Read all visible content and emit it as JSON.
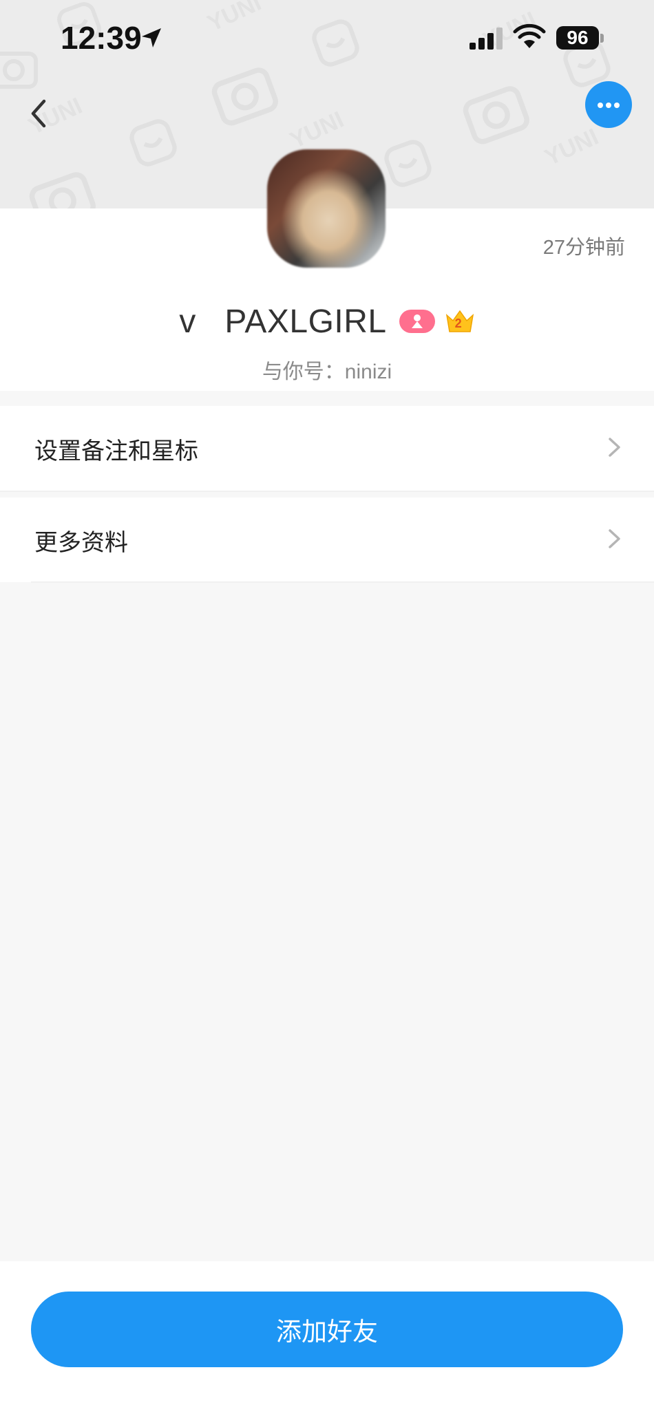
{
  "status_bar": {
    "time": "12:39",
    "battery": "96",
    "icons": [
      "location-arrow-icon",
      "cellular-signal-icon",
      "wifi-icon",
      "battery-icon"
    ]
  },
  "header": {
    "watermark_text": "YUNI",
    "back_icon": "chevron-left-icon",
    "more_icon": "ellipsis-icon",
    "accent_color": "#2196f3"
  },
  "profile": {
    "last_active": "27分钟前",
    "nickname": "v   PAXLGIRL",
    "badges": [
      "gender-female-icon",
      "crown-level-icon"
    ],
    "crown_level": "2",
    "account_line": "与你号：ninizi"
  },
  "menu": {
    "items": [
      {
        "label": "设置备注和星标"
      },
      {
        "label": "更多资料"
      }
    ]
  },
  "footer": {
    "add_friend_label": "添加好友",
    "button_color": "#1e96f4"
  }
}
